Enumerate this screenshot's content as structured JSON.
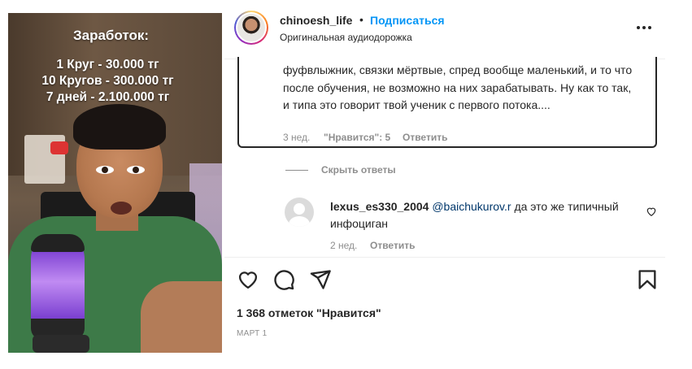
{
  "media": {
    "overlay": {
      "title": "Заработок:",
      "lines": [
        "1 Круг - 30.000 тг",
        "10 Кругов - 300.000 тг",
        "7 дней - 2.100.000 тг"
      ]
    }
  },
  "header": {
    "username": "chinoesh_life",
    "separator": "•",
    "follow_label": "Подписаться",
    "audio_label": "Оригинальная аудиодорожка"
  },
  "comment": {
    "text": "фуфвлыжник, связки мёртвые, спред вообще маленький, и то что после обучения, не возможно на них зарабатывать. Ну как то так, и типа это говорит твой ученик с первого потока....",
    "time": "3 нед.",
    "likes": "\"Нравится\": 5",
    "reply_label": "Ответить"
  },
  "replies_toggle": {
    "label": "Скрыть ответы"
  },
  "reply": {
    "username": "lexus_es330_2004",
    "mention": "@baichukurov.r",
    "text": " да это же типичный инфоциган",
    "time": "2 нед.",
    "reply_label": "Ответить"
  },
  "footer": {
    "likes": "1 368 отметок \"Нравится\"",
    "date": "МАРТ 1"
  },
  "icons": {
    "like": "heart-icon",
    "comment": "comment-icon",
    "share": "paper-plane-icon",
    "save": "bookmark-icon",
    "more": "more-horizontal-icon",
    "reply_like": "heart-icon"
  },
  "colors": {
    "accent": "#0095f6",
    "text": "#262626",
    "muted": "#8e8e8e",
    "mention": "#00376b"
  }
}
